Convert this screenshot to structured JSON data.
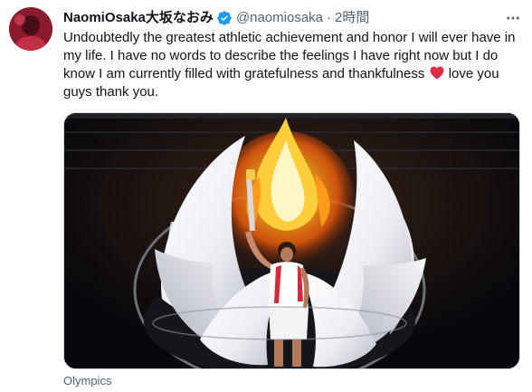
{
  "author": {
    "display_name": "NaomiOsaka大坂なおみ",
    "handle": "@naomiosaka",
    "separator": "·",
    "time": "2時間",
    "verified": true
  },
  "tweet": {
    "text_before_heart": "Undoubtedly the greatest athletic achievement and honor I will ever have in my life. I have no words to describe the feelings I have right now but I do know I am currently filled with gratefulness and thankfulness ",
    "text_after_heart": " love you guys thank you."
  },
  "media": {
    "caption": "Olympics"
  },
  "icons": {
    "verified": "verified-badge-icon",
    "more": "more-options-icon",
    "heart": "red-heart-emoji-icon"
  },
  "colors": {
    "text_primary": "#0f1419",
    "text_secondary": "#536471",
    "verified_blue": "#1d9bf0",
    "heart_red": "#dd2e44"
  }
}
